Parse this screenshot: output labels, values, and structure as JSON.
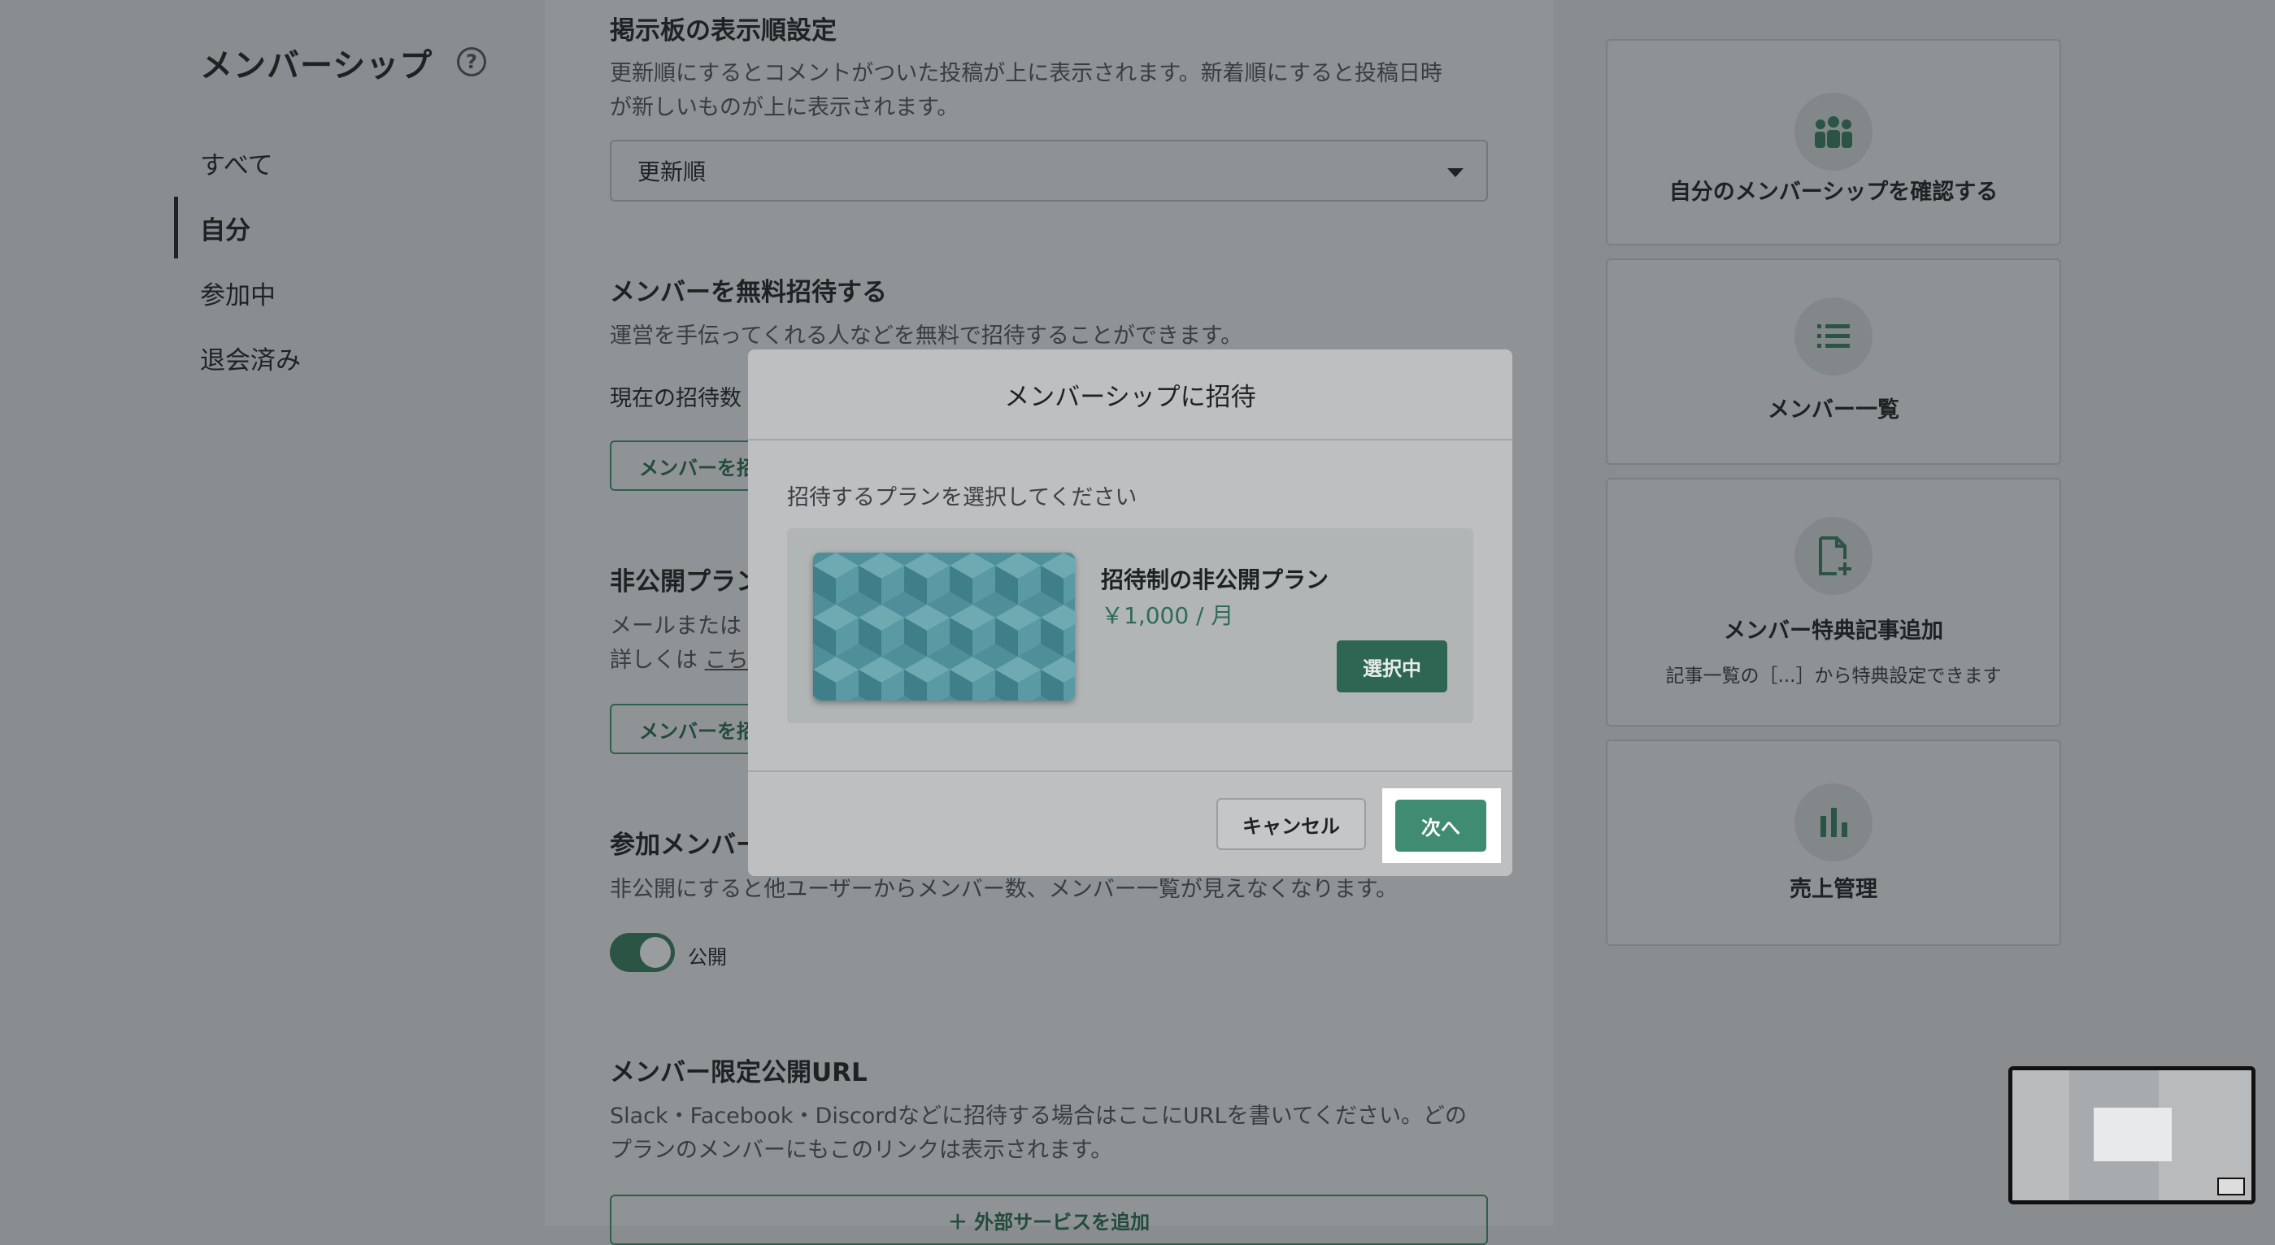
{
  "sidebar": {
    "title": "メンバーシップ",
    "help_icon": "?",
    "items": [
      {
        "label": "すべて"
      },
      {
        "label": "自分"
      },
      {
        "label": "参加中"
      },
      {
        "label": "退会済み"
      }
    ]
  },
  "main": {
    "board_order": {
      "title": "掲示板の表示順設定",
      "desc_line1": "更新順にするとコメントがついた投稿が上に表示されます。新着順にすると投稿日時",
      "desc_line2": "が新しいものが上に表示されます。",
      "select_value": "更新順"
    },
    "free_invite": {
      "title": "メンバーを無料招待する",
      "desc": "運営を手伝ってくれる人などを無料で招待することができます。",
      "current_count_label": "現在の招待数",
      "button_label": "メンバーを招"
    },
    "private_plan": {
      "title": "非公開プラン",
      "desc_line1": "メールまたは",
      "desc_line2_prefix": "詳しくは ",
      "desc_link": "こち",
      "button_label": "メンバーを招"
    },
    "member_visibility": {
      "title": "参加メンバー",
      "desc": "非公開にすると他ユーザーからメンバー数、メンバー一覧が見えなくなります。",
      "toggle_label": "公開",
      "toggle_on": true
    },
    "limited_url": {
      "title": "メンバー限定公開URL",
      "desc_line1": "Slack・Facebook・Discordなどに招待する場合はここにURLを書いてください。どの",
      "desc_line2": "プランのメンバーにもこのリンクは表示されます。",
      "button_label": "＋ 外部サービスを追加"
    }
  },
  "right_cards": [
    {
      "icon": "group-icon",
      "label": "自分のメンバーシップを確認する"
    },
    {
      "icon": "list-icon",
      "label": "メンバー一覧"
    },
    {
      "icon": "add-document-icon",
      "label": "メンバー特典記事追加",
      "sub": "記事一覧の［...］から特典設定できます"
    },
    {
      "icon": "bar-chart-icon",
      "label": "売上管理"
    }
  ],
  "modal": {
    "title": "メンバーシップに招待",
    "prompt": "招待するプランを選択してください",
    "plan": {
      "name": "招待制の非公開プラン",
      "price": "￥1,000 / 月",
      "selected_label": "選択中"
    },
    "cancel_label": "キャンセル",
    "next_label": "次へ"
  },
  "colors": {
    "accent_green": "#3f8c72",
    "dark_green": "#2e6553",
    "overlay_gray": "#8a8d8f"
  }
}
